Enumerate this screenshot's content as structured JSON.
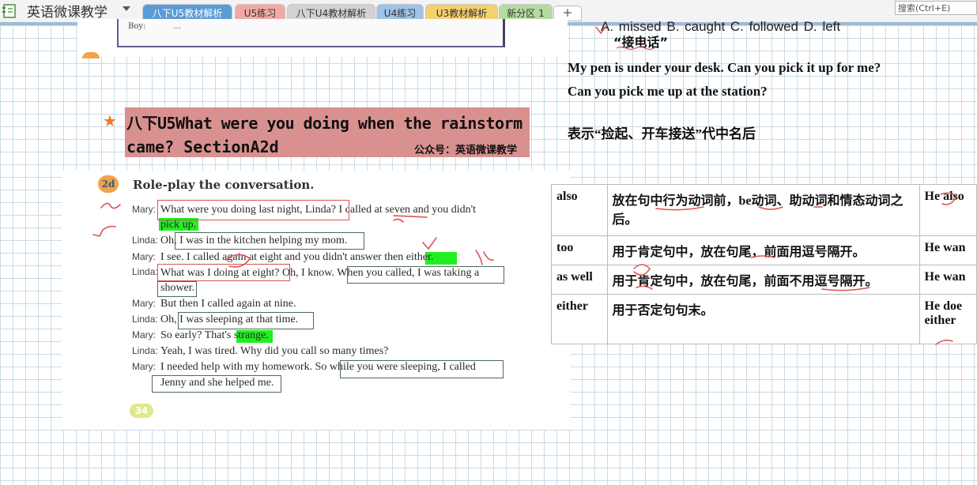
{
  "app": {
    "notebook_name": "英语微课教学",
    "search_placeholder": "搜索(Ctrl+E)"
  },
  "tabs": [
    {
      "label": "八下U5教材解析",
      "color": "#5b9bd5",
      "active": true
    },
    {
      "label": "U5练习",
      "color": "#f2a9a4",
      "active": false
    },
    {
      "label": "八下U4教材解析",
      "color": "#c7c7c7",
      "active": false
    },
    {
      "label": "U4练习",
      "color": "#9dc3e6",
      "active": false
    },
    {
      "label": "U3教材解析",
      "color": "#f4d06f",
      "active": false
    },
    {
      "label": "新分区 1",
      "color": "#b6dba0",
      "active": false
    }
  ],
  "add_tab_label": "+",
  "book_header": {
    "boy_label": "Boy:",
    "boy_text": "..."
  },
  "title": {
    "line1": "八下U5What were you doing when the rainstorm",
    "line2": "came?  SectionA2d",
    "wechat": "公众号：英语微课教学"
  },
  "lesson": {
    "badge": "2d",
    "task": "Role-play the conversation.",
    "page": "34",
    "lines": [
      {
        "speaker": "Mary:",
        "text": "What were you doing last night, Linda? I called at seven and you didn't"
      },
      {
        "speaker": "",
        "text": "pick up."
      },
      {
        "speaker": "Linda:",
        "text": "Oh, I was in the kitchen helping my mom."
      },
      {
        "speaker": "Mary:",
        "text": "I see. I called again at eight and you didn't answer then either."
      },
      {
        "speaker": "Linda:",
        "text": "What was I doing at eight? Oh, I know. When you called, I was taking a"
      },
      {
        "speaker": "",
        "text": "shower."
      },
      {
        "speaker": "Mary:",
        "text": "But then I called again at nine."
      },
      {
        "speaker": "Linda:",
        "text": "Oh, I was sleeping at that time."
      },
      {
        "speaker": "Mary:",
        "text": "So early? That's strange."
      },
      {
        "speaker": "Linda:",
        "text": "Yeah, I was tired. Why did you call so many times?"
      },
      {
        "speaker": "Mary:",
        "text": "I needed help with my homework. So while you were sleeping, I called"
      },
      {
        "speaker": "",
        "text": "Jenny and she helped me."
      }
    ]
  },
  "notes": {
    "prev_options": "A. missed   B. caught    C. followed    D. left",
    "phrase_label": "“接电话”",
    "example1": "My pen is under your desk. Can you pick it up for me?",
    "example2": "Can you pick me up at the station?",
    "meaning": "表示“捡起、开车接送”代中名后"
  },
  "comparison_table": [
    {
      "word": "also",
      "usage": "放在句中行为动词前，be动词、助动词和情态动词之后。",
      "example": "He also"
    },
    {
      "word": "too",
      "usage": "用于肯定句中，放在句尾，前面用逗号隔开。",
      "example": "He wan"
    },
    {
      "word": "as well",
      "usage": "用于肯定句中，放在句尾，前面不用逗号隔开。",
      "example": "He wan"
    },
    {
      "word": "either",
      "usage": "用于否定句句末。",
      "example": "He doe either"
    }
  ],
  "colors": {
    "annotation_red": "#d9534f",
    "highlight_green": "#22ee22",
    "title_bg": "#d9918f"
  }
}
